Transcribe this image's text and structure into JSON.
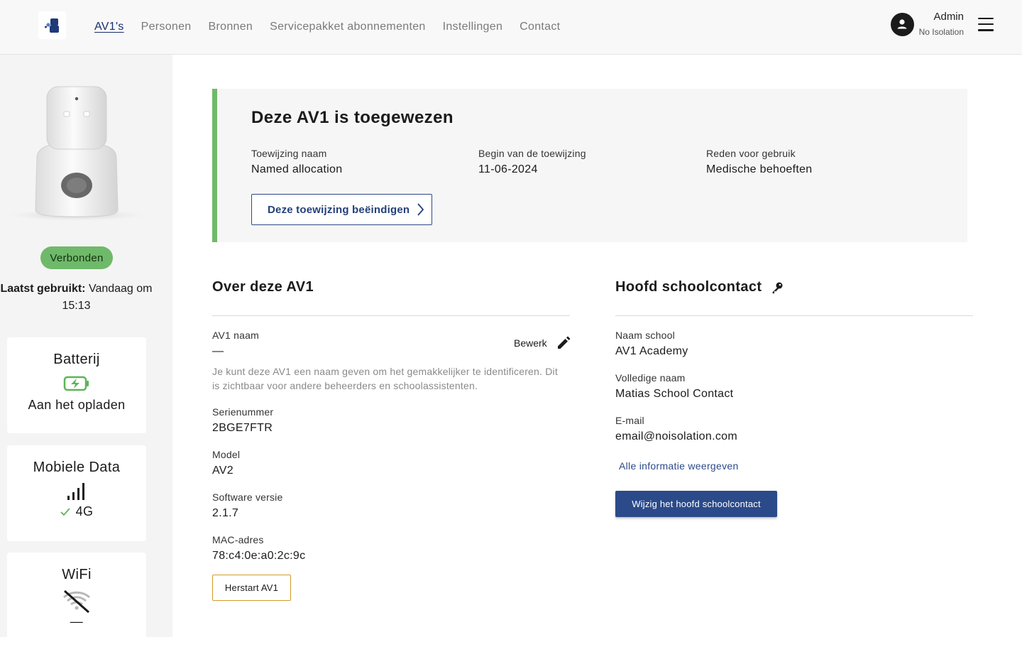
{
  "header": {
    "nav": [
      "AV1's",
      "Personen",
      "Bronnen",
      "Servicepakket abonnementen",
      "Instellingen",
      "Contact"
    ],
    "user_name": "Admin",
    "user_org": "No Isolation"
  },
  "sidebar": {
    "status": "Verbonden",
    "last_used_label": "Laatst gebruikt:",
    "last_used_value": "Vandaag om 15:13",
    "battery": {
      "title": "Batterij",
      "value": "Aan het opladen"
    },
    "mobile": {
      "title": "Mobiele Data",
      "value": "4G"
    },
    "wifi": {
      "title": "WiFi",
      "value": "—"
    }
  },
  "allocation": {
    "title": "Deze AV1 is toegewezen",
    "fields": [
      {
        "label": "Toewijzing naam",
        "value": "Named allocation"
      },
      {
        "label": "Begin van de toewijzing",
        "value": "11-06-2024"
      },
      {
        "label": "Reden voor gebruik",
        "value": "Medische behoeften"
      }
    ],
    "end_button": "Deze toewijzing beëindigen"
  },
  "about": {
    "title": "Over deze AV1",
    "name_label": "AV1 naam",
    "name_value": "—",
    "edit_label": "Bewerk",
    "help": "Je kunt deze AV1 een naam geven om het gemakkelijker te identificeren. Dit is zichtbaar voor andere beheerders en schoolassistenten.",
    "fields": [
      {
        "label": "Serienummer",
        "value": "2BGE7FTR"
      },
      {
        "label": "Model",
        "value": "AV2"
      },
      {
        "label": "Software versie",
        "value": "2.1.7"
      },
      {
        "label": "MAC-adres",
        "value": "78:c4:0e:a0:2c:9c"
      }
    ],
    "restart_button": "Herstart AV1"
  },
  "contact": {
    "title": "Hoofd schoolcontact",
    "fields": [
      {
        "label": "Naam school",
        "value": "AV1 Academy"
      },
      {
        "label": "Volledige naam",
        "value": "Matias School Contact"
      },
      {
        "label": "E-mail",
        "value": "email@noisolation.com"
      }
    ],
    "show_all_link": "Alle informatie weergeven",
    "change_button": "Wijzig het hoofd schoolcontact"
  },
  "colors": {
    "accent": "#2b4a8a",
    "connected": "#6fb96a",
    "restart_border": "#d39a2a"
  },
  "icons": [
    "av1-logo-icon",
    "user-avatar-icon",
    "hamburger-menu-icon",
    "battery-charging-icon",
    "signal-bars-icon",
    "check-icon",
    "wifi-off-icon",
    "chevron-right-icon",
    "pencil-icon",
    "key-icon"
  ]
}
